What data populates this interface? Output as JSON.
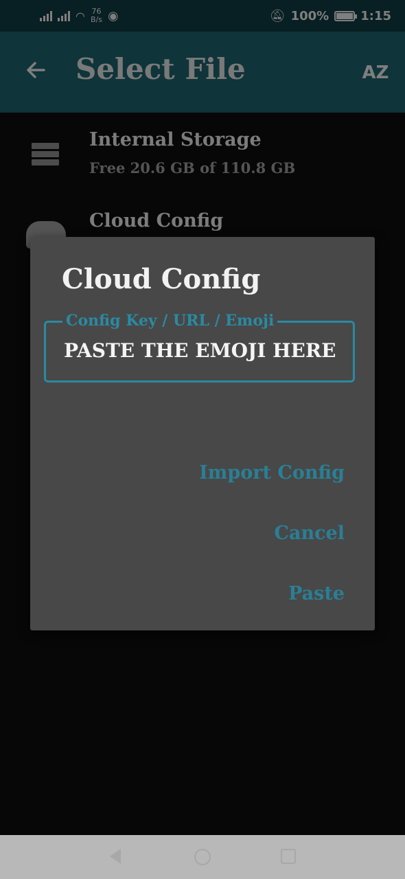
{
  "status_bar": {
    "speed_value": "76",
    "speed_unit": "B/s",
    "battery": "100%",
    "time": "1:15"
  },
  "app_bar": {
    "title": "Select File",
    "back_icon": "arrow-left-icon",
    "sort_icon": "sort-az-icon",
    "sort_label": "AZ"
  },
  "list": [
    {
      "title": "Internal Storage",
      "subtitle": "Free 20.6 GB of 110.8 GB",
      "icon": "storage-icon"
    },
    {
      "title": "Cloud Config",
      "icon": "cloud-icon"
    }
  ],
  "dialog": {
    "title": "Cloud Config",
    "field_label": "Config Key / URL / Emoji",
    "field_value": "PASTE THE EMOJI HERE",
    "buttons": {
      "import": "Import Config",
      "cancel": "Cancel",
      "paste": "Paste"
    }
  },
  "colors": {
    "app_bar": "#1d5f69",
    "status_bar": "#0f3a40",
    "accent": "#2a8aa3",
    "dialog_bg": "#484848"
  }
}
